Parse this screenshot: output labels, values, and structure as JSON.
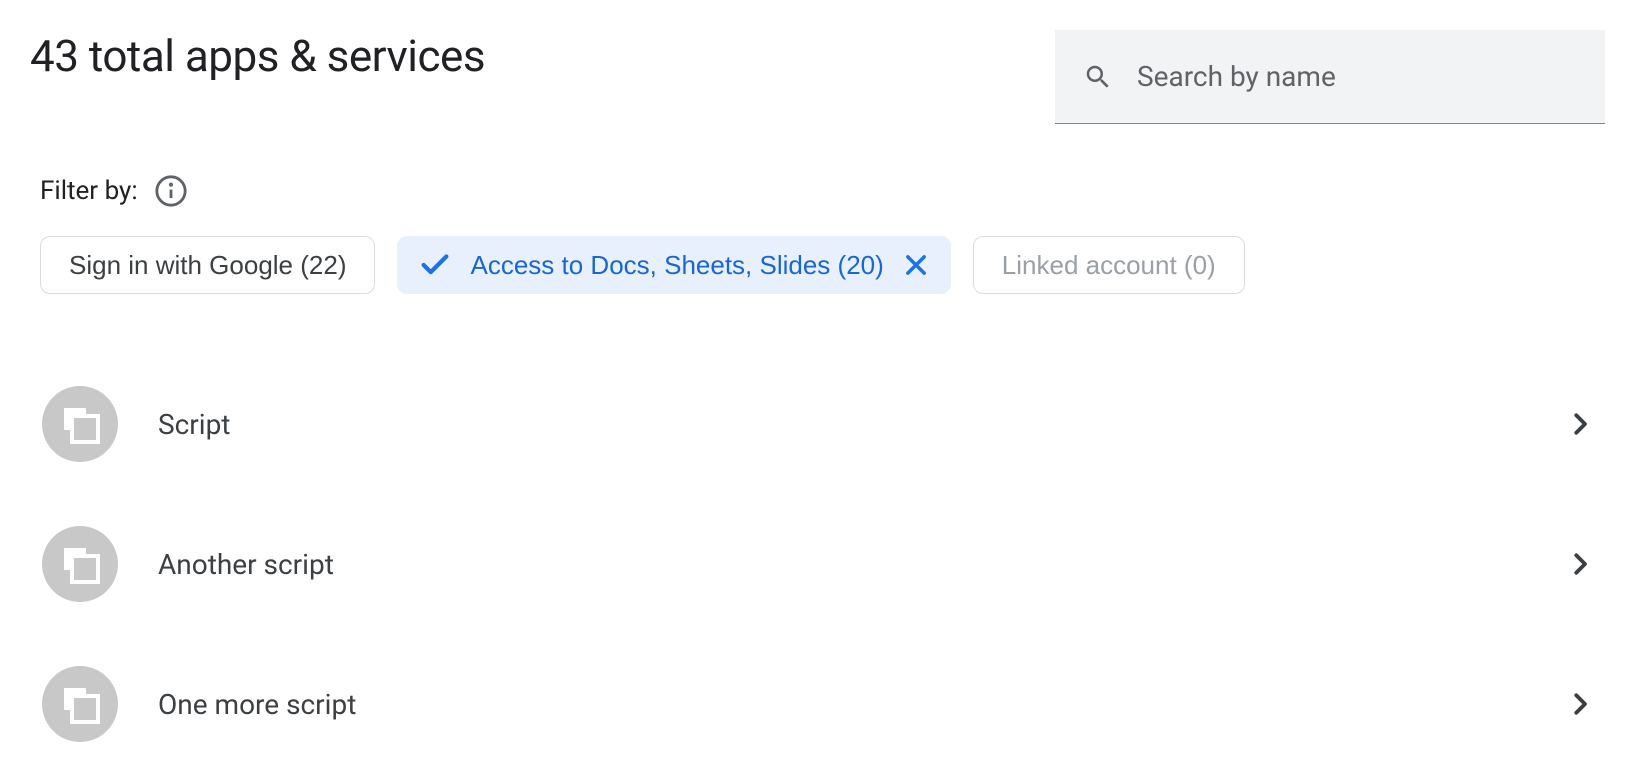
{
  "header": {
    "title": "43 total apps & services"
  },
  "search": {
    "placeholder": "Search by name",
    "value": ""
  },
  "filter": {
    "label": "Filter by:",
    "chips": [
      {
        "label": "Sign in with Google (22)",
        "selected": false,
        "disabled": false
      },
      {
        "label": "Access to Docs, Sheets, Slides (20)",
        "selected": true,
        "disabled": false
      },
      {
        "label": "Linked account (0)",
        "selected": false,
        "disabled": true
      }
    ]
  },
  "apps": [
    {
      "name": "Script"
    },
    {
      "name": "Another script"
    },
    {
      "name": "One more script"
    }
  ]
}
